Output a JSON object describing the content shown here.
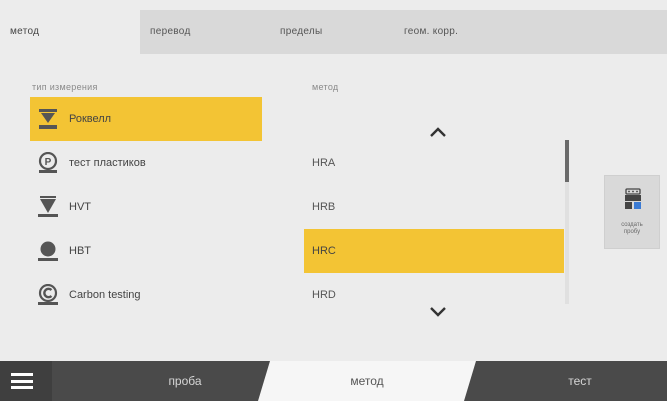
{
  "tabs": [
    {
      "label": "метод",
      "active": true
    },
    {
      "label": "перевод",
      "active": false
    },
    {
      "label": "пределы",
      "active": false
    },
    {
      "label": "геом. корр.",
      "active": false
    }
  ],
  "measurement_types": {
    "header": "тип измерения",
    "items": [
      {
        "label": "Роквелл",
        "icon": "rockwell-icon",
        "selected": true
      },
      {
        "label": "тест пластиков",
        "icon": "plastics-test-icon",
        "selected": false
      },
      {
        "label": "HVT",
        "icon": "hvt-icon",
        "selected": false
      },
      {
        "label": "HBT",
        "icon": "hbt-icon",
        "selected": false
      },
      {
        "label": "Carbon testing",
        "icon": "carbon-testing-icon",
        "selected": false
      }
    ]
  },
  "methods": {
    "header": "метод",
    "items": [
      {
        "label": "HRA",
        "selected": false
      },
      {
        "label": "HRB",
        "selected": false
      },
      {
        "label": "HRC",
        "selected": true
      },
      {
        "label": "HRD",
        "selected": false
      }
    ],
    "scroll_up_icon": "chevron-up-icon",
    "scroll_down_icon": "chevron-down-icon"
  },
  "create_sample": {
    "line1": "создать",
    "line2": "пробу",
    "icon": "sample-holder-icon"
  },
  "bottom_nav": {
    "menu_icon": "hamburger-menu-icon",
    "tabs": [
      {
        "label": "проба",
        "active": false
      },
      {
        "label": "метод",
        "active": true
      },
      {
        "label": "тест",
        "active": false
      }
    ]
  },
  "colors": {
    "selected_highlight": "#f3c434",
    "bottom_bar": "#4a4a4a",
    "tab_bar": "#d9d9d9"
  }
}
